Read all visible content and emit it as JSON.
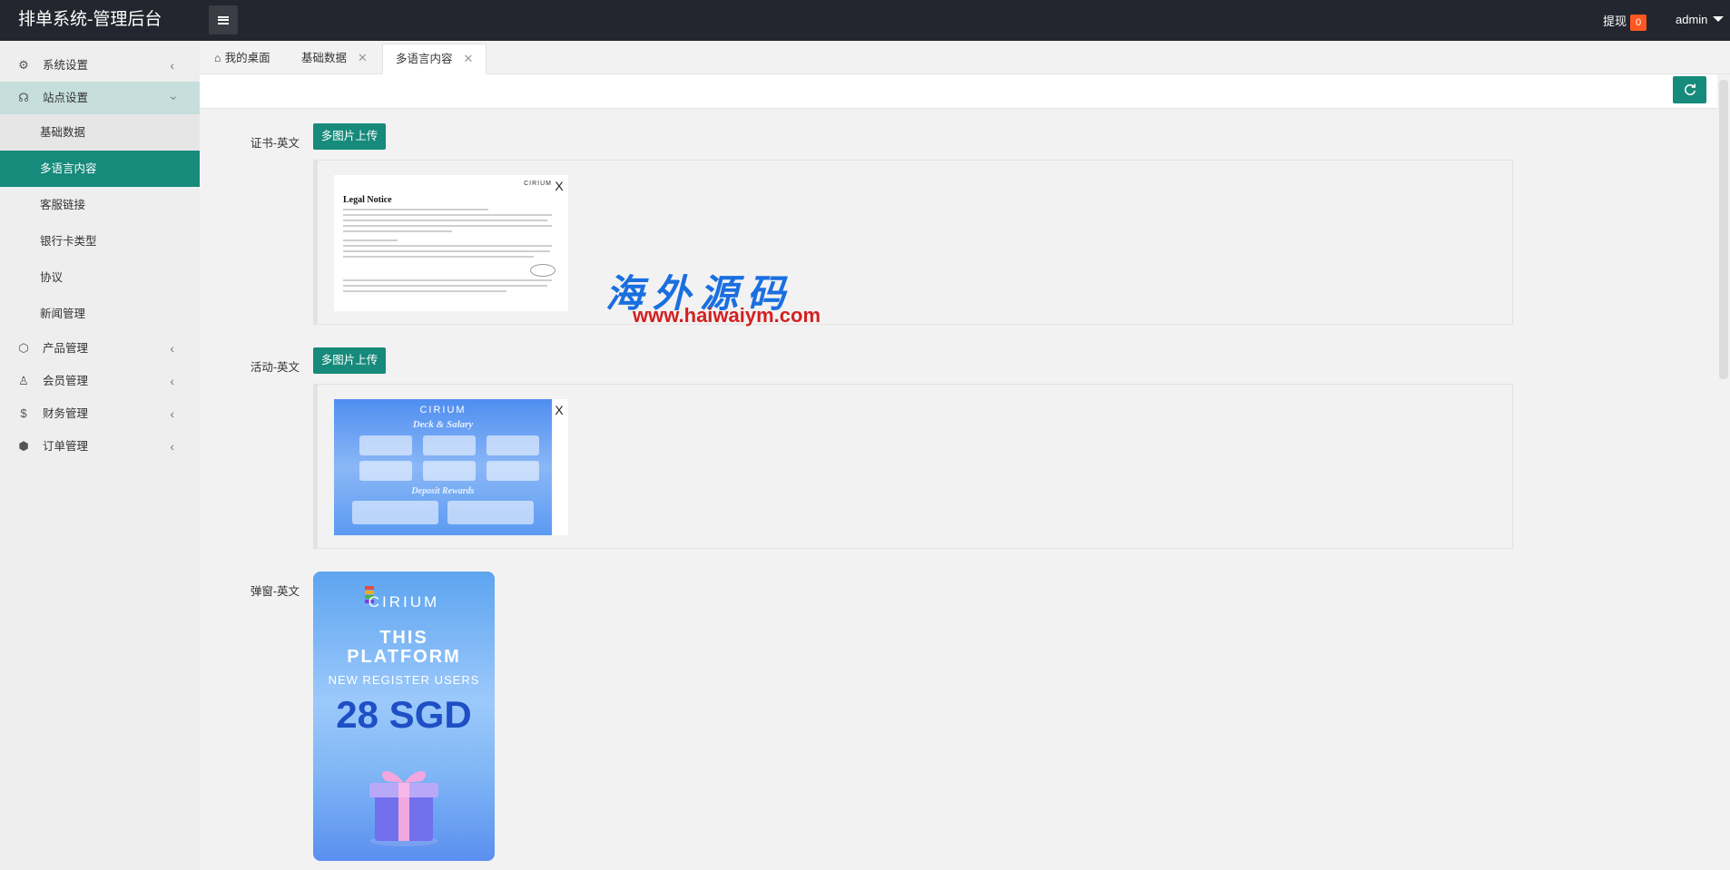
{
  "app": {
    "title": "排单系统-管理后台"
  },
  "header": {
    "withdraw_label": "提现",
    "withdraw_count": "0",
    "user_name": "admin"
  },
  "sidebar": {
    "items": [
      {
        "label": "系统设置",
        "icon": "gear-icon"
      },
      {
        "label": "站点设置",
        "icon": "headset-icon"
      },
      {
        "label": "产品管理",
        "icon": "cube-icon"
      },
      {
        "label": "会员管理",
        "icon": "user-icon"
      },
      {
        "label": "财务管理",
        "icon": "dollar-icon"
      },
      {
        "label": "订单管理",
        "icon": "box-icon"
      }
    ],
    "sub_items": [
      "基础数据",
      "多语言内容",
      "客服链接",
      "银行卡类型",
      "协议",
      "新闻管理"
    ]
  },
  "tabs": [
    {
      "label": "我的桌面"
    },
    {
      "label": "基础数据"
    },
    {
      "label": "多语言内容"
    }
  ],
  "form": {
    "certificate_label": "证书-英文",
    "activity_label": "活动-英文",
    "popup_label": "弹窗-英文",
    "upload_button": "多图片上传",
    "remove_symbol": "X"
  },
  "images": {
    "legal_notice": {
      "title": "Legal Notice",
      "brand": "CIRIUM"
    },
    "activity": {
      "brand": "CIRIUM",
      "title": "Deck & Salary",
      "subtitle": "Deposit Rewards"
    },
    "popup": {
      "brand": "CIRIUM",
      "line1": "THIS",
      "line2": "PLATFORM",
      "line3": "NEW REGISTER USERS",
      "amount": "28 SGD"
    }
  },
  "watermark": {
    "text": "海外源码",
    "url": "www.haiwaiym.com"
  },
  "colors": {
    "primary": "#168a7b",
    "header_bg": "#23262e",
    "badge": "#ff5722"
  }
}
